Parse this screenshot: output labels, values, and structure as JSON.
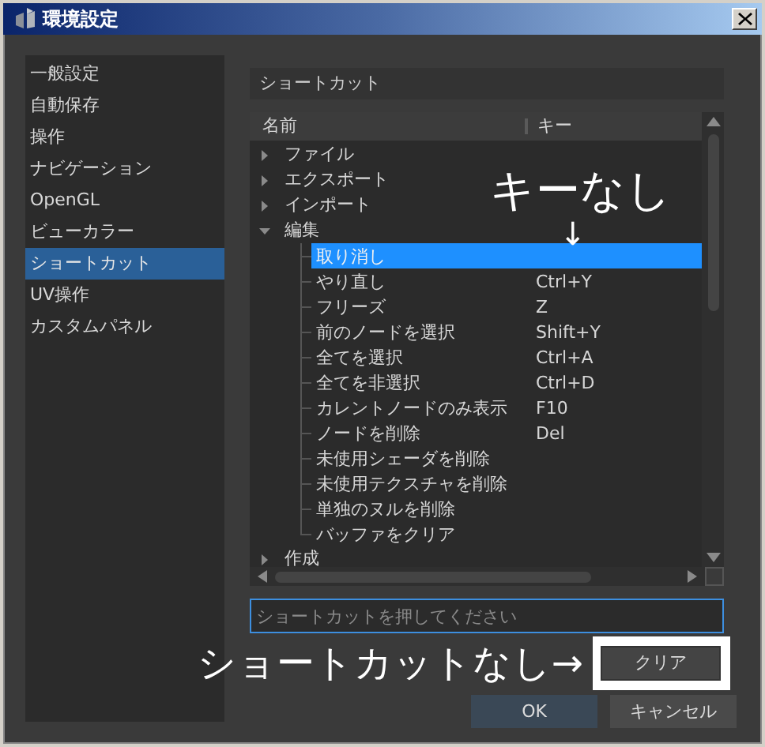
{
  "window": {
    "title": "環境設定"
  },
  "sidebar": {
    "items": [
      {
        "label": "一般設定",
        "selected": false
      },
      {
        "label": "自動保存",
        "selected": false
      },
      {
        "label": "操作",
        "selected": false
      },
      {
        "label": "ナビゲーション",
        "selected": false
      },
      {
        "label": "OpenGL",
        "selected": false
      },
      {
        "label": "ビューカラー",
        "selected": false
      },
      {
        "label": "ショートカット",
        "selected": true
      },
      {
        "label": "UV操作",
        "selected": false
      },
      {
        "label": "カスタムパネル",
        "selected": false
      }
    ]
  },
  "section": {
    "title": "ショートカット"
  },
  "tree": {
    "columns": [
      "名前",
      "キー"
    ],
    "items": [
      {
        "label": "ファイル",
        "expanded": false
      },
      {
        "label": "エクスポート",
        "expanded": false
      },
      {
        "label": "インポート",
        "expanded": false
      },
      {
        "label": "編集",
        "expanded": true,
        "children": [
          {
            "label": "取り消し",
            "selected": true
          },
          {
            "label": "やり直し",
            "key": "Ctrl+Y",
            "selected": false
          },
          {
            "label": "フリーズ",
            "key": "Z",
            "selected": false
          },
          {
            "label": "前のノードを選択",
            "key": "Shift+Y",
            "selected": false
          },
          {
            "label": "全てを選択",
            "key": "Ctrl+A",
            "selected": false
          },
          {
            "label": "全てを非選択",
            "key": "Ctrl+D",
            "selected": false
          },
          {
            "label": "カレントノードのみ表示",
            "key": "F10",
            "selected": false
          },
          {
            "label": "ノードを削除",
            "key": "Del",
            "selected": false
          },
          {
            "label": "未使用シェーダを削除",
            "selected": false
          },
          {
            "label": "未使用テクスチャを削除",
            "selected": false
          },
          {
            "label": "単独のヌルを削除",
            "selected": false
          },
          {
            "label": "バッファをクリア",
            "selected": false
          }
        ]
      },
      {
        "label": "作成",
        "expanded": false
      }
    ]
  },
  "shortcut_field": {
    "placeholder": "ショートカットを押してください"
  },
  "buttons": [
    {
      "label": "クリア",
      "kind": "clear",
      "framed": true
    },
    {
      "label": "OK",
      "kind": "ok",
      "default": true
    },
    {
      "label": "キャンセル",
      "kind": "cancel",
      "default": false
    }
  ],
  "annotations": [
    {
      "text": "キーなし"
    },
    {
      "text": "↓"
    },
    {
      "text": "ショートカットなし→"
    }
  ]
}
